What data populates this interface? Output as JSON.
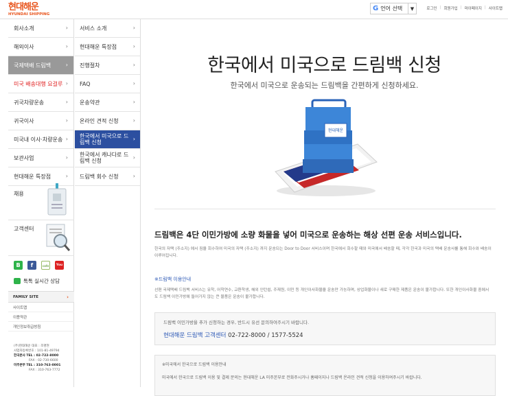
{
  "header": {
    "logo_ko": "현대해운",
    "logo_en": "HYUNDAI SHIPPING",
    "translate": {
      "brand": "G",
      "label": "언어 선택",
      "arrow": "▼"
    },
    "links": [
      "로그인",
      "회원가입",
      "마이페이지",
      "사이트맵"
    ]
  },
  "nav1": [
    {
      "label": "회사소개"
    },
    {
      "label": "해외이사"
    },
    {
      "label": "국제택배 드림백"
    },
    {
      "label": "미국 배송대행 요걸루"
    },
    {
      "label": "귀국차량운송"
    },
    {
      "label": "귀국이사"
    },
    {
      "label": "미국내 이사·차량운송"
    },
    {
      "label": "보관사업"
    },
    {
      "label": "현대해운 특장점"
    }
  ],
  "nav2": [
    {
      "label": "서비스 소개"
    },
    {
      "label": "현대해운 특장점"
    },
    {
      "label": "진행절차"
    },
    {
      "label": "FAQ"
    },
    {
      "label": "운송약관"
    },
    {
      "label": "온라인 견적 신청"
    },
    {
      "label": "한국에서 미국으로 드림백 신청"
    },
    {
      "label": "한국에서 캐나다로 드림백 신청"
    },
    {
      "label": "드림백 회수 신청"
    }
  ],
  "chevron": "›",
  "side_cards": {
    "recruit": "채용",
    "customer_center": "고객센터",
    "sns": [
      "B",
      "f",
      "cafe",
      "You"
    ],
    "talk": "톡톡 실시간 상담"
  },
  "family": {
    "title": "FAMILY SITE",
    "items": [
      "사이트맵",
      "이용약관",
      "개인정보취급방침"
    ]
  },
  "address": {
    "company": "(주)현대해운  대표 : 조명현",
    "bizno": "사업자등록번호 : 101-81-49794",
    "kr_label": "한국본사",
    "kr_tel": "TEL : 02-722-8000",
    "kr_fax": "FAX : 02-730-6600",
    "us_label": "미주본부",
    "us_tel": "TEL : 310-763-0001",
    "us_fax": "FAX : 310-763-7772"
  },
  "main": {
    "title": "한국에서 미국으로 드림백 신청",
    "subtitle": "한국에서 미국으로 운송되는 드림백을 간편하게 신청하세요.",
    "bag_text": "현대해운",
    "desc_title": "드림백은 4단 이민가방에 소량 화물을 넣어 미국으로 운송하는 해상 선편 운송 서비스입니다.",
    "desc": "한국의 자택 (주소지) 에서 짐을 회수하여 미국의 자택 (주소지) 까지 운송되는 Door to Door 서비스이며 한국에서 회수할 때와 미국에서 배송할 때, 각각 한국과 미국의 택배 운송사를 통해 회수와 배송이 이루어집니다.",
    "link": "※드림백 이용안내",
    "desc2": "선편 국제택배 드림백 서비스는 유학, 어학연수, 교환학생, 해외 인턴쉽, 주재원, 이민 등 개인이사화물을 운송만 가능하며, 상업화물이나 새로 구매한 제품은 운송이 불가합니다. 또한 개인이사화물 중에서도 드림백 이민가방에 들어가지 않는 큰 물품은 운송이 불가합니다.",
    "box1": {
      "line1": "드림백 이민가방을 추가 신청하는 경우, 반드시 유선 문의하여주시기 바랍니다.",
      "center": "현대해운 드림백 고객센터",
      "phone": "02-722-8000 / 1577-5524"
    },
    "box2": {
      "line1": "※미국에서 한국으로 드림백 이용안내",
      "line2": "미국에서 한국으로 드림백 이용 및 결제 문의는 현대해운 LA 미주본부로 전화주시거나 홈페이지나 드림백 온라인 견적 신청을 이용하여주시기 바랍니다."
    }
  }
}
